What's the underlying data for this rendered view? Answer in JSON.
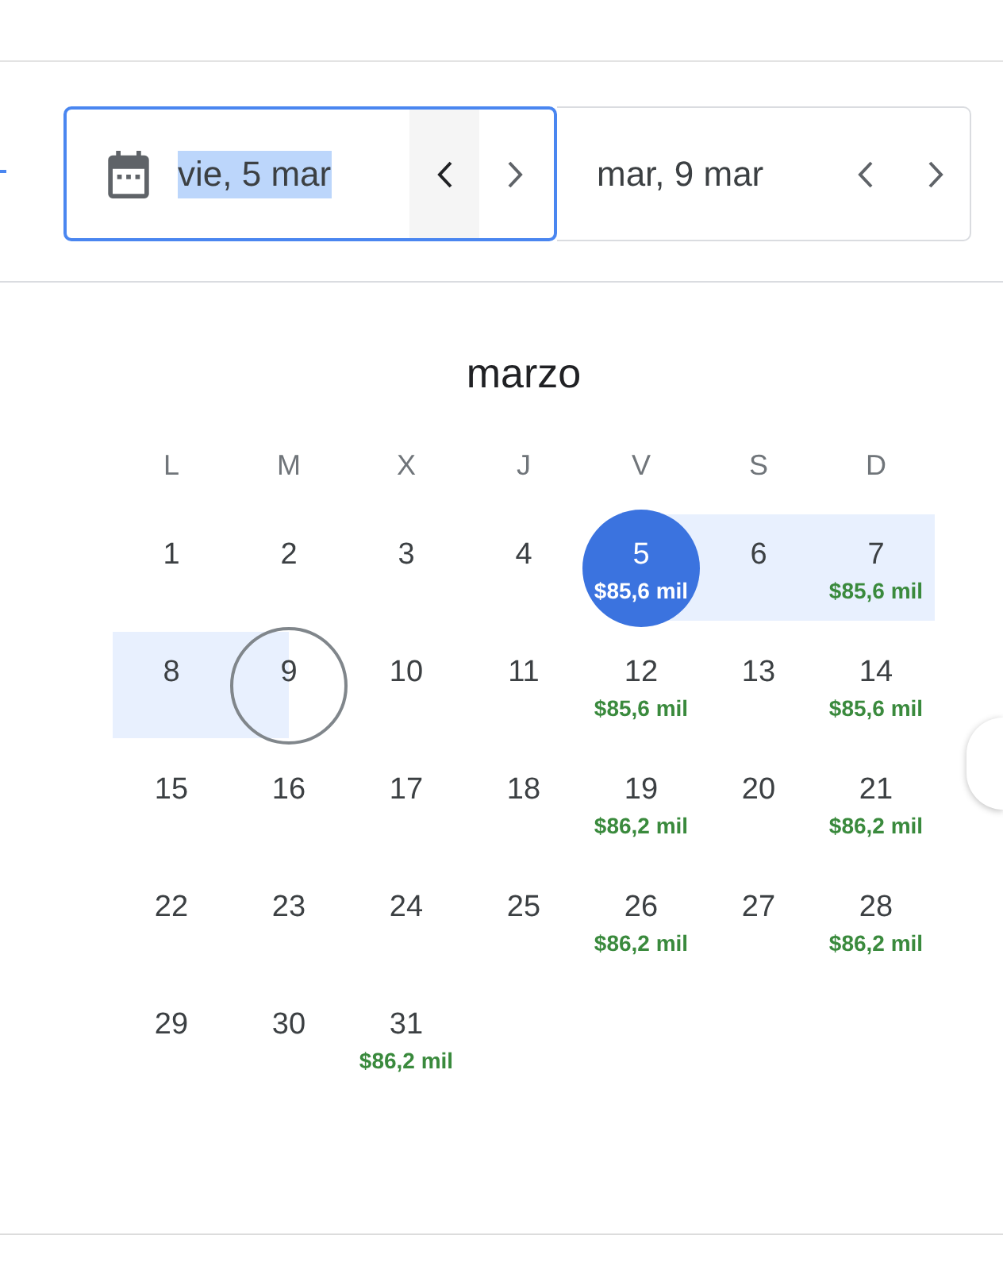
{
  "header": {
    "date_fields": [
      {
        "kind": "start",
        "value": "vie, 5 mar",
        "focused": true,
        "text_selected": true,
        "nav": [
          {
            "kind": "prev",
            "hovered": true
          },
          {
            "kind": "next",
            "hovered": false
          }
        ]
      },
      {
        "kind": "end",
        "value": "mar, 9 mar",
        "focused": false,
        "text_selected": false,
        "nav": [
          {
            "kind": "prev",
            "hovered": false
          },
          {
            "kind": "next",
            "hovered": false
          }
        ]
      }
    ]
  },
  "calendar": {
    "month": "marzo",
    "weekdays": [
      "L",
      "M",
      "X",
      "J",
      "V",
      "S",
      "D"
    ],
    "days": [
      {
        "day": "1",
        "selected": false,
        "in_range": false,
        "outlined": false
      },
      {
        "day": "2",
        "selected": false,
        "in_range": false,
        "outlined": false
      },
      {
        "day": "3",
        "selected": false,
        "in_range": false,
        "outlined": false
      },
      {
        "day": "4",
        "selected": false,
        "in_range": false,
        "outlined": false
      },
      {
        "day": "5",
        "price": "$85,6 mil",
        "selected": true,
        "in_range": true,
        "outlined": false
      },
      {
        "day": "6",
        "selected": false,
        "in_range": true,
        "outlined": false
      },
      {
        "day": "7",
        "price": "$85,6 mil",
        "selected": false,
        "in_range": true,
        "outlined": false
      },
      {
        "day": "8",
        "selected": false,
        "in_range": true,
        "outlined": false
      },
      {
        "day": "9",
        "selected": false,
        "in_range": true,
        "outlined": true
      },
      {
        "day": "10",
        "selected": false,
        "in_range": false,
        "outlined": false
      },
      {
        "day": "11",
        "selected": false,
        "in_range": false,
        "outlined": false
      },
      {
        "day": "12",
        "price": "$85,6 mil",
        "selected": false,
        "in_range": false,
        "outlined": false
      },
      {
        "day": "13",
        "selected": false,
        "in_range": false,
        "outlined": false
      },
      {
        "day": "14",
        "price": "$85,6 mil",
        "selected": false,
        "in_range": false,
        "outlined": false
      },
      {
        "day": "15",
        "selected": false,
        "in_range": false,
        "outlined": false
      },
      {
        "day": "16",
        "selected": false,
        "in_range": false,
        "outlined": false
      },
      {
        "day": "17",
        "selected": false,
        "in_range": false,
        "outlined": false
      },
      {
        "day": "18",
        "selected": false,
        "in_range": false,
        "outlined": false
      },
      {
        "day": "19",
        "price": "$86,2 mil",
        "selected": false,
        "in_range": false,
        "outlined": false
      },
      {
        "day": "20",
        "selected": false,
        "in_range": false,
        "outlined": false
      },
      {
        "day": "21",
        "price": "$86,2 mil",
        "selected": false,
        "in_range": false,
        "outlined": false
      },
      {
        "day": "22",
        "selected": false,
        "in_range": false,
        "outlined": false
      },
      {
        "day": "23",
        "selected": false,
        "in_range": false,
        "outlined": false
      },
      {
        "day": "24",
        "selected": false,
        "in_range": false,
        "outlined": false
      },
      {
        "day": "25",
        "selected": false,
        "in_range": false,
        "outlined": false
      },
      {
        "day": "26",
        "price": "$86,2 mil",
        "selected": false,
        "in_range": false,
        "outlined": false
      },
      {
        "day": "27",
        "selected": false,
        "in_range": false,
        "outlined": false
      },
      {
        "day": "28",
        "price": "$86,2 mil",
        "selected": false,
        "in_range": false,
        "outlined": false
      },
      {
        "day": "29",
        "selected": false,
        "in_range": false,
        "outlined": false
      },
      {
        "day": "30",
        "selected": false,
        "in_range": false,
        "outlined": false
      },
      {
        "day": "31",
        "price": "$86,2 mil",
        "selected": false,
        "in_range": false,
        "outlined": false
      }
    ]
  }
}
